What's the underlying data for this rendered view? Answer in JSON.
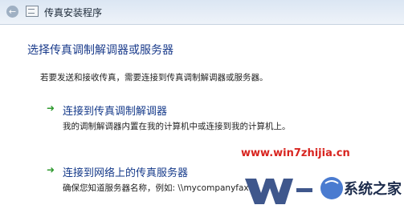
{
  "window": {
    "title": "传真安装程序"
  },
  "heading": "选择传真调制解调器或服务器",
  "description": "若要发送和接收传真，需要连接到传真调制解调器或服务器。",
  "options": [
    {
      "icon": "green-arrow-icon",
      "title": "连接到传真调制解调器",
      "subtitle": "我的调制解调器内置在我的计算机中或连接到我的计算机上。"
    },
    {
      "icon": "green-arrow-icon",
      "title": "连接到网络上的传真服务器",
      "subtitle": "确保您知道服务器名称，例如: \\\\mycompanyfax"
    }
  ],
  "watermark": {
    "url": "www.win7zhijia.cn",
    "brand_text": "系统之家"
  },
  "colors": {
    "heading": "#1a3b8b",
    "arrow": "#2f9a2f",
    "watermark_url": "#d8241f"
  }
}
